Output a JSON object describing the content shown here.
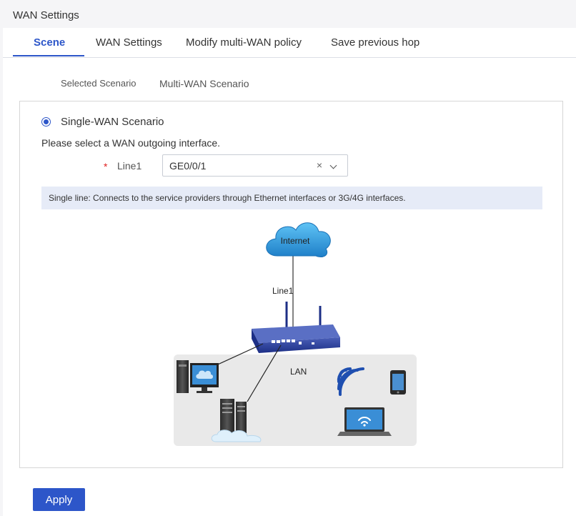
{
  "page": {
    "title": "WAN Settings"
  },
  "tabs": [
    {
      "label": "Scene"
    },
    {
      "label": "WAN Settings"
    },
    {
      "label": "Modify multi-WAN policy"
    },
    {
      "label": "Save previous hop"
    }
  ],
  "subtabs": [
    {
      "label": "Selected Scenario"
    },
    {
      "label": "Multi-WAN Scenario"
    }
  ],
  "scenario": {
    "option_label": "Single-WAN Scenario",
    "prompt": "Please select a WAN outgoing interface.",
    "required_mark": "*",
    "line_label": "Line1",
    "line_value": "GE0/0/1",
    "clear_glyph": "×",
    "info": "Single line: Connects to the service providers through Ethernet interfaces or 3G/4G interfaces."
  },
  "diagram": {
    "cloud_label": "Internet",
    "line_label": "Line1",
    "lan_label": "LAN"
  },
  "actions": {
    "apply_label": "Apply"
  },
  "colors": {
    "accent": "#2d56c9",
    "info_bg": "#e6ebf7",
    "required": "#e02020"
  }
}
